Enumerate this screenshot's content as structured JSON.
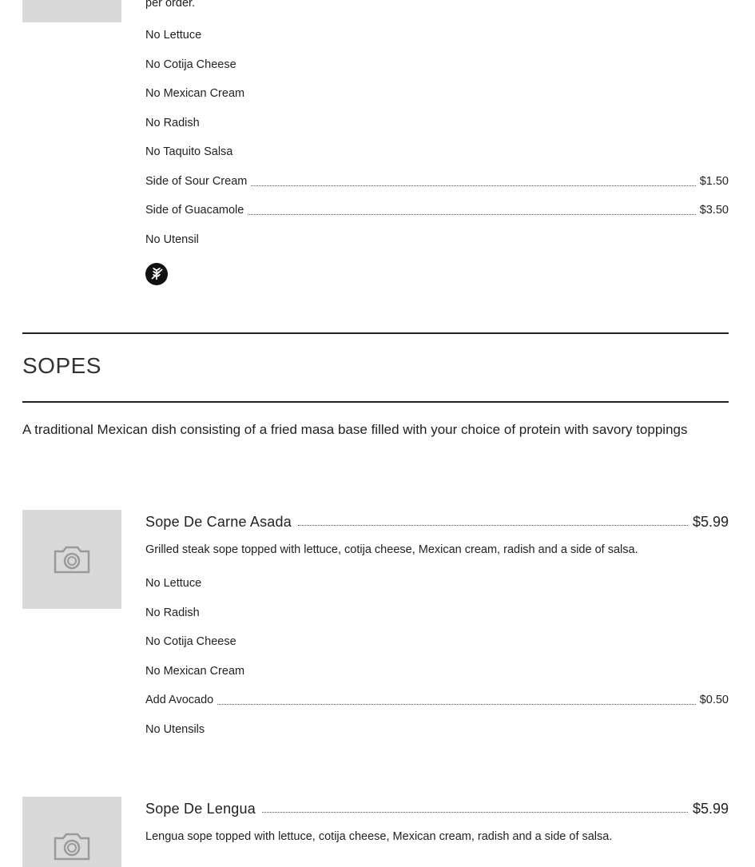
{
  "prev_item": {
    "desc_tail": "per order.",
    "options": [
      {
        "name": "No Lettuce",
        "price": ""
      },
      {
        "name": "No Cotija Cheese",
        "price": ""
      },
      {
        "name": "No Mexican Cream",
        "price": ""
      },
      {
        "name": "No Radish",
        "price": ""
      },
      {
        "name": "No Taquito Salsa",
        "price": ""
      },
      {
        "name": "Side of Sour Cream",
        "price": "$1.50"
      },
      {
        "name": "Side of Guacamole",
        "price": "$3.50"
      },
      {
        "name": "No Utensil",
        "price": ""
      }
    ],
    "badge_icon": "gluten-free-icon"
  },
  "section": {
    "title": "SOPES",
    "description": "A traditional Mexican dish consisting of a fried masa base filled with your choice of protein with savory toppings"
  },
  "items": [
    {
      "name": "Sope De Carne Asada",
      "price": "$5.99",
      "description": "Grilled steak sope topped with lettuce, cotija cheese, Mexican cream, radish and a side of salsa.",
      "image_icon": "camera-icon",
      "options": [
        {
          "name": "No Lettuce",
          "price": ""
        },
        {
          "name": "No Radish",
          "price": ""
        },
        {
          "name": "No Cotija Cheese",
          "price": ""
        },
        {
          "name": "No Mexican Cream",
          "price": ""
        },
        {
          "name": "Add Avocado",
          "price": "$0.50"
        },
        {
          "name": "No Utensils",
          "price": ""
        }
      ]
    },
    {
      "name": "Sope De Lengua",
      "price": "$5.99",
      "description": "Lengua sope topped with lettuce, cotija cheese, Mexican cream, radish and a side of salsa.",
      "image_icon": "camera-icon"
    }
  ],
  "colors": {
    "text": "#222222",
    "placeholder_bg": "#d9d9d9",
    "camera_icon": "#9a9a9a",
    "rule": "#222222"
  }
}
